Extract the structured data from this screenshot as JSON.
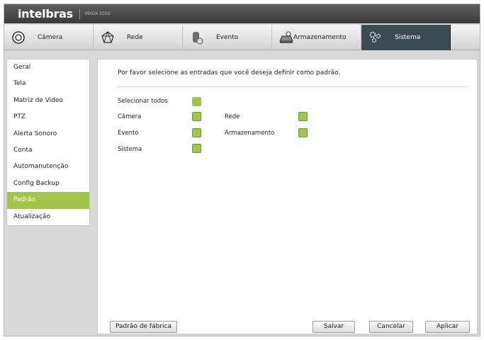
{
  "header": {
    "brand": "intelbras",
    "model": "MHDX 1032"
  },
  "tabs": [
    {
      "label": "Câmera",
      "icon": "camera-icon"
    },
    {
      "label": "Rede",
      "icon": "network-icon"
    },
    {
      "label": "Evento",
      "icon": "event-icon"
    },
    {
      "label": "Armazenamento",
      "icon": "storage-icon"
    },
    {
      "label": "Sistema",
      "icon": "gears-icon",
      "active": true
    }
  ],
  "sidebar": {
    "items": [
      "Geral",
      "Tela",
      "Matriz de Video",
      "PTZ",
      "Alerta Sonoro",
      "Conta",
      "Automanutenção",
      "Config Backup",
      "Padrão",
      "Atualização"
    ],
    "active": "Padrão"
  },
  "main": {
    "instruction": "Por favor selecione as entradas que você deseja definir como padrão.",
    "select_all": "Selecionar todos",
    "options": {
      "camera": "Câmera",
      "rede": "Rede",
      "evento": "Evento",
      "armazenamento": "Armazenamento",
      "sistema": "Sistema"
    }
  },
  "buttons": {
    "factory": "Padrão de fábrica",
    "save": "Salvar",
    "cancel": "Cancelar",
    "apply": "Aplicar"
  },
  "colors": {
    "accent": "#a2c64a",
    "active_tab": "#3c4a52",
    "titlebar": "#4a4a4a"
  }
}
